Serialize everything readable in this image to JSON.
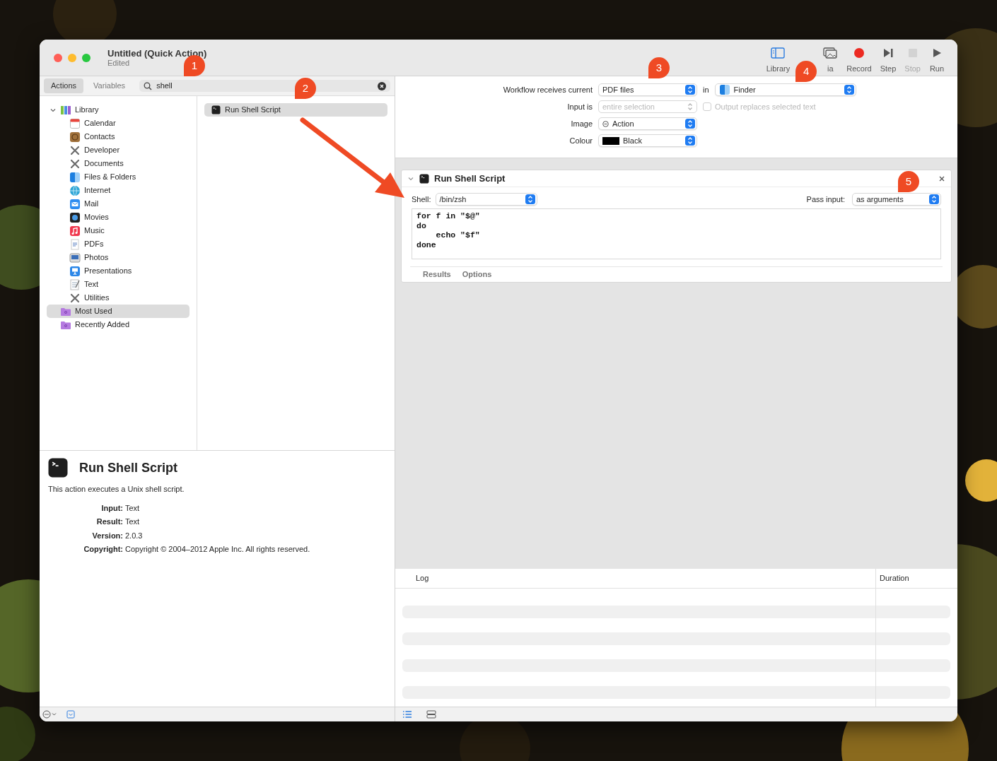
{
  "window": {
    "title": "Untitled (Quick Action)",
    "subtitle": "Edited"
  },
  "toolbar": [
    {
      "kind": "library",
      "label": "Library",
      "disabled": false
    },
    {
      "kind": "media",
      "label": "ia",
      "disabled": false
    },
    {
      "kind": "record",
      "label": "Record",
      "disabled": false
    },
    {
      "kind": "step",
      "label": "Step",
      "disabled": false
    },
    {
      "kind": "stop",
      "label": "Stop",
      "disabled": true
    },
    {
      "kind": "run",
      "label": "Run",
      "disabled": false
    }
  ],
  "library_tabs": [
    {
      "label": "Actions",
      "selected": true
    },
    {
      "label": "Variables",
      "selected": false
    }
  ],
  "search": {
    "value": "shell"
  },
  "library_tree": {
    "label": "Library",
    "kind": "books",
    "expanded": true,
    "selected": false,
    "children": [
      {
        "label": "Calendar",
        "kind": "calendar",
        "selected": false
      },
      {
        "label": "Contacts",
        "kind": "contacts",
        "selected": false
      },
      {
        "label": "Developer",
        "kind": "tools",
        "selected": false
      },
      {
        "label": "Documents",
        "kind": "tools",
        "selected": false
      },
      {
        "label": "Files & Folders",
        "kind": "finder",
        "selected": false
      },
      {
        "label": "Internet",
        "kind": "globe",
        "selected": false
      },
      {
        "label": "Mail",
        "kind": "mail",
        "selected": false
      },
      {
        "label": "Movies",
        "kind": "movies",
        "selected": false
      },
      {
        "label": "Music",
        "kind": "music",
        "selected": false
      },
      {
        "label": "PDFs",
        "kind": "pdf",
        "selected": false
      },
      {
        "label": "Photos",
        "kind": "photos",
        "selected": false
      },
      {
        "label": "Presentations",
        "kind": "presentations",
        "selected": false
      },
      {
        "label": "Text",
        "kind": "text",
        "selected": false
      },
      {
        "label": "Utilities",
        "kind": "tools",
        "selected": false
      }
    ]
  },
  "smart_groups": [
    {
      "label": "Most Used",
      "selected": true
    },
    {
      "label": "Recently Added",
      "selected": false
    }
  ],
  "actions": [
    {
      "label": "Run Shell Script",
      "selected": true
    }
  ],
  "description": {
    "title": "Run Shell Script",
    "text": "This action executes a Unix shell script.",
    "fields": [
      {
        "key": "Input:",
        "value": "Text"
      },
      {
        "key": "Result:",
        "value": "Text"
      },
      {
        "key": "Version:",
        "value": "2.0.3"
      },
      {
        "key": "Copyright:",
        "value": "Copyright © 2004–2012 Apple Inc. All rights reserved."
      }
    ]
  },
  "workflow_settings": {
    "receives_label": "Workflow receives current",
    "receives": "PDF files",
    "in_label": "in",
    "app": "Finder",
    "input_is_label": "Input is",
    "input_is": {
      "value": "entire selection",
      "disabled": true
    },
    "output_replaces": {
      "label": "Output replaces selected text",
      "checked": false,
      "disabled": true
    },
    "image_label": "Image",
    "image": "Action",
    "colour_label": "Colour",
    "colour": {
      "value": "Black",
      "color": "#000000"
    }
  },
  "action_card": {
    "title": "Run Shell Script",
    "expanded": true,
    "shell_label": "Shell:",
    "shell": "/bin/zsh",
    "pass_input_label": "Pass input:",
    "pass_input": "as arguments",
    "script": "for f in \"$@\"\ndo\n    echo \"$f\"\ndone",
    "tabs": [
      {
        "label": "Results",
        "selected": false
      },
      {
        "label": "Options",
        "selected": false
      }
    ]
  },
  "log": {
    "columns": [
      "Log",
      "Duration"
    ]
  },
  "annotations": [
    {
      "kind": "callout",
      "text": "1"
    },
    {
      "kind": "callout",
      "text": "2"
    },
    {
      "kind": "callout",
      "text": "3"
    },
    {
      "kind": "callout",
      "text": "4"
    },
    {
      "kind": "callout",
      "text": "5"
    },
    {
      "kind": "arrow"
    }
  ]
}
